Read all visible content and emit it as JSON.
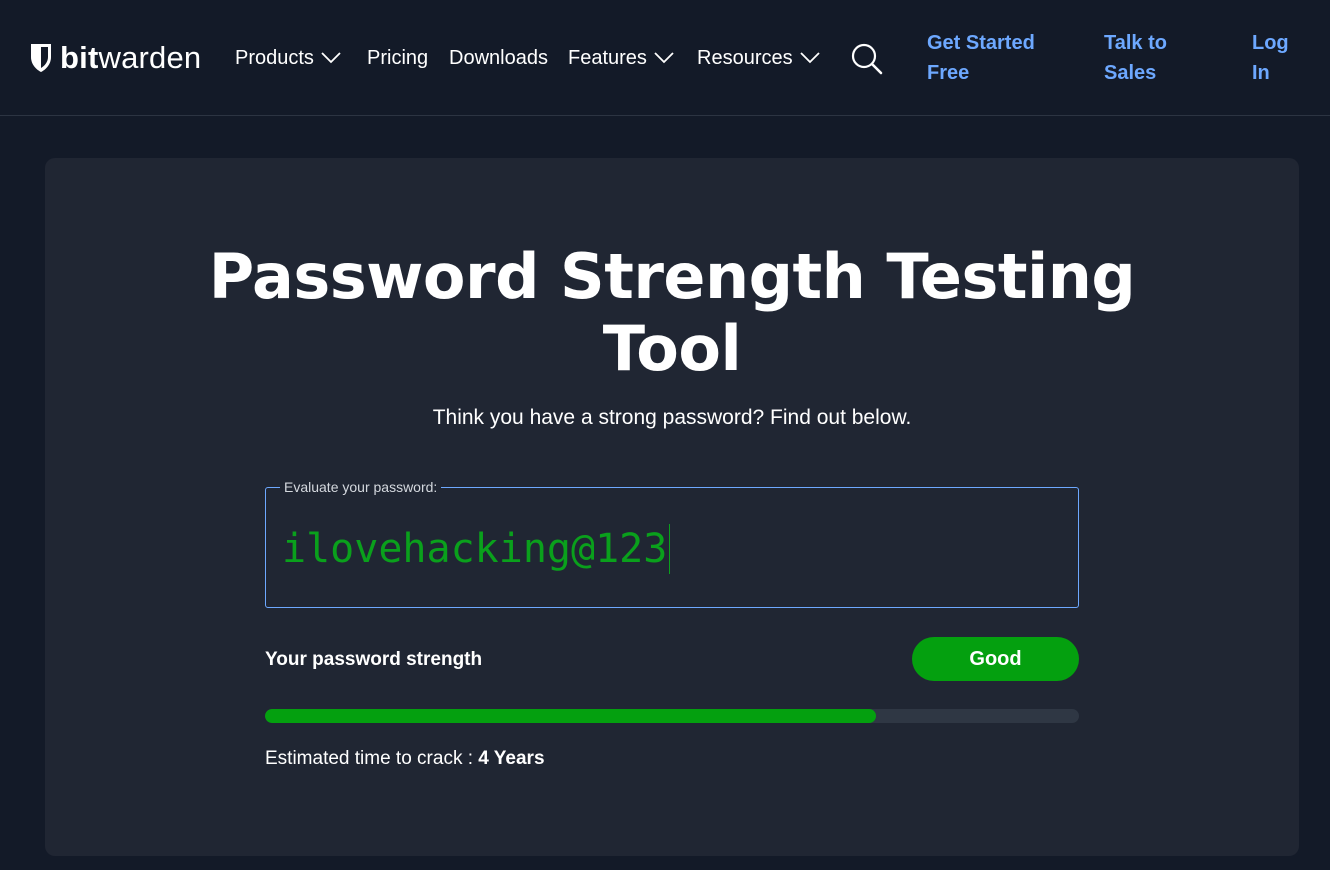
{
  "header": {
    "logo": {
      "bold": "bit",
      "regular": "warden"
    },
    "nav": [
      {
        "label": "Products",
        "dropdown": true
      },
      {
        "label": "Pricing",
        "dropdown": false
      },
      {
        "label": "Downloads",
        "dropdown": false
      },
      {
        "label": "Features",
        "dropdown": true
      },
      {
        "label": "Resources",
        "dropdown": true
      }
    ],
    "search_icon": "search-icon",
    "links": {
      "get_started": [
        "Get Started",
        "Free"
      ],
      "talk_to_sales": [
        "Talk to",
        "Sales"
      ],
      "log_in": [
        "Log",
        "In"
      ]
    }
  },
  "main": {
    "title_line1": "Password Strength Testing",
    "title_line2": "Tool",
    "subtitle": "Think you have a strong password? Find out below.",
    "password_field": {
      "legend": "Evaluate your password:",
      "value": "ilovehacking@123"
    },
    "strength": {
      "label": "Your password strength",
      "rating": "Good",
      "progress_percent": 75
    },
    "crack_time": {
      "label": "Estimated time to crack :",
      "value": "4 Years"
    }
  },
  "colors": {
    "background": "#131a28",
    "card": "#202633",
    "accent_link": "#6da8ff",
    "good": "#04a00f",
    "password_text": "#0aa01c"
  }
}
